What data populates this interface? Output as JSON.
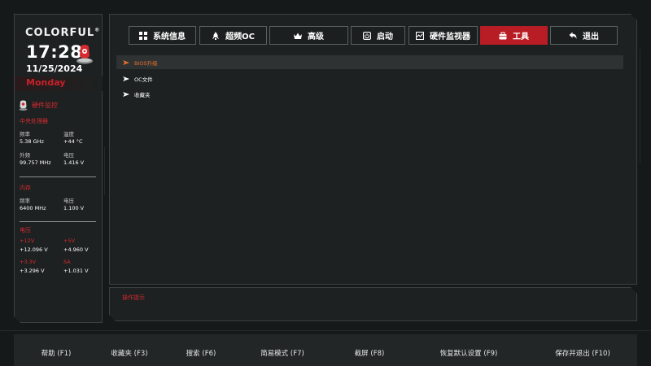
{
  "brand": {
    "name": "COLORFUL",
    "mark": "®"
  },
  "clock": {
    "time": "17:28",
    "date": "11/25/2024",
    "weekday": "Monday"
  },
  "monitor": {
    "title": "硬件监控",
    "cpu": {
      "title": "中央处理器",
      "freq_label": "频率",
      "freq_value": "5.38 GHz",
      "temp_label": "温度",
      "temp_value": "+44 °C",
      "ext_label": "外频",
      "ext_value": "99.757 MHz",
      "volt_label": "电压",
      "volt_value": "1.416 V"
    },
    "memory": {
      "title": "内存",
      "freq_label": "频率",
      "freq_value": "6400 MHz",
      "volt_label": "电压",
      "volt_value": "1.100 V"
    },
    "voltage": {
      "title": "电压",
      "items": [
        {
          "label": "+12V",
          "value": "+12.096 V"
        },
        {
          "label": "+5V",
          "value": "+4.960 V"
        },
        {
          "label": "+3.3V",
          "value": "+3.296 V"
        },
        {
          "label": "SA",
          "value": "+1.031 V"
        }
      ]
    }
  },
  "tabs": [
    {
      "label": "系统信息",
      "icon": "grid-icon"
    },
    {
      "label": "超频OC",
      "icon": "rocket-icon"
    },
    {
      "label": "高级",
      "icon": "crown-icon"
    },
    {
      "label": "启动",
      "icon": "power-icon"
    },
    {
      "label": "硬件监视器",
      "icon": "monitor-chart-icon"
    },
    {
      "label": "工具",
      "icon": "toolbox-icon",
      "active": true
    },
    {
      "label": "退出",
      "icon": "back-arrow-icon"
    }
  ],
  "menu": [
    {
      "label": "BIOS升级",
      "selected": true
    },
    {
      "label": "OC文件"
    },
    {
      "label": "收藏夹"
    }
  ],
  "hint": {
    "label": "操作提示"
  },
  "footer": [
    {
      "label": "帮助 (F1)"
    },
    {
      "label": "收藏夹 (F3)"
    },
    {
      "label": "搜索 (F6)"
    },
    {
      "label": "简易模式 (F7)"
    },
    {
      "label": "截屏 (F8)"
    },
    {
      "label": "恢复默认设置 (F9)"
    },
    {
      "label": "保存并退出 (F10)"
    }
  ],
  "colors": {
    "accent": "#b81c24",
    "selected_text": "#e4702a",
    "label_red": "#d32a31"
  }
}
